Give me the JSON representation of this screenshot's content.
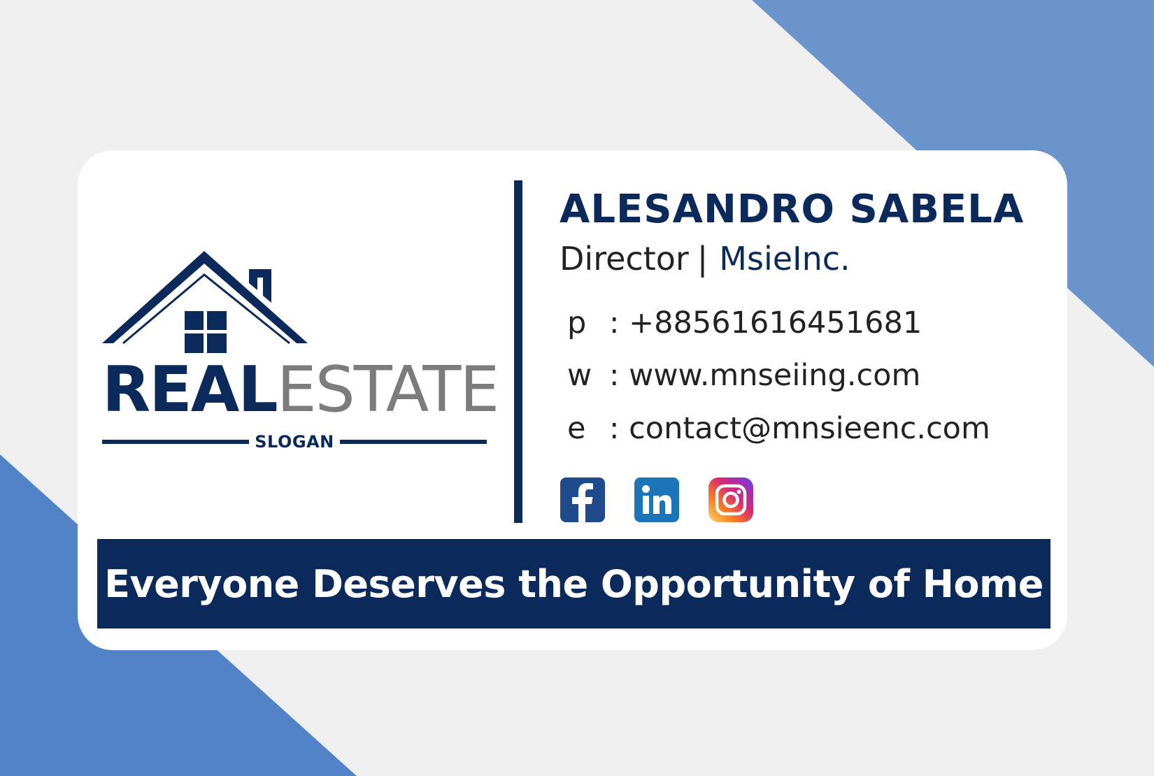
{
  "logo": {
    "word_primary": "REAL",
    "word_secondary": "ESTATE",
    "slogan": "SLOGAN"
  },
  "person": {
    "name": "ALESANDRO SABELA",
    "title": "Director",
    "separator": "|",
    "company": "MsieInc."
  },
  "contacts": [
    {
      "key": "p",
      "value": ": +88561616451681"
    },
    {
      "key": "w",
      "value": ": www.mnseiing.com"
    },
    {
      "key": "e",
      "value": ": contact@mnsieenc.com"
    }
  ],
  "socials": [
    {
      "icon": "facebook-icon"
    },
    {
      "icon": "linkedin-icon"
    },
    {
      "icon": "instagram-icon"
    }
  ],
  "banner": {
    "text": "Everyone Deserves the Opportunity of Home"
  },
  "colors": {
    "navy": "#0b2a5b",
    "accent_blue": "#6b93cc",
    "background": "#efefef",
    "gray": "#7c7c7c"
  }
}
